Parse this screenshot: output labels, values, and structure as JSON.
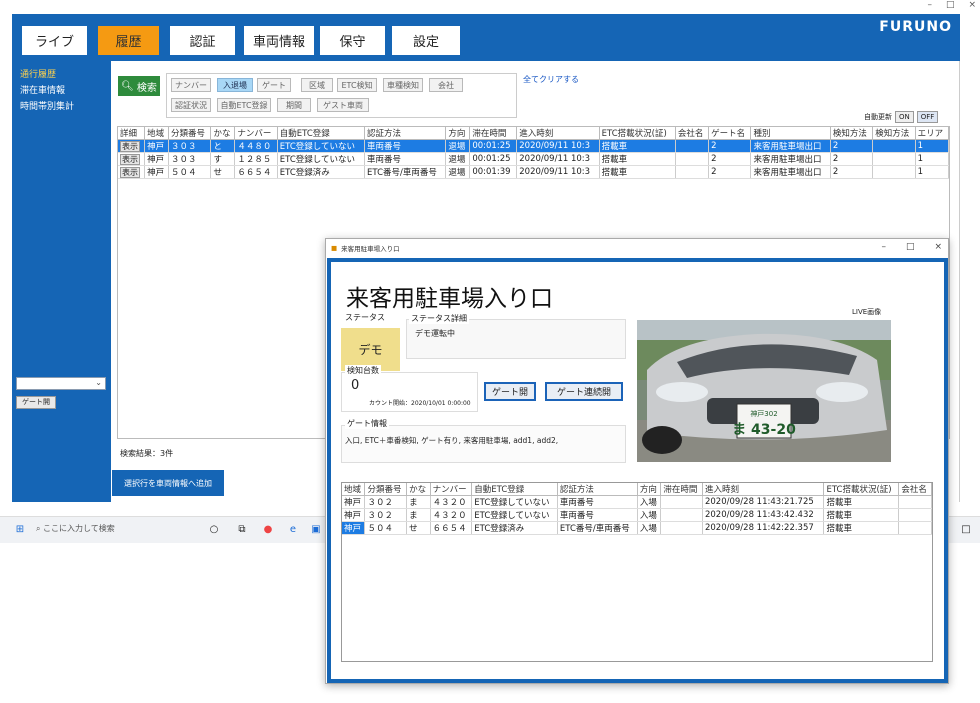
{
  "window": {
    "controls": [
      "–",
      "□",
      "×"
    ]
  },
  "brand": "FURUNO",
  "tabs": [
    {
      "label": "ライブ",
      "active": false
    },
    {
      "label": "履歴",
      "active": true
    },
    {
      "label": "認証",
      "active": false
    },
    {
      "label": "車両情報",
      "active": false
    },
    {
      "label": "保守",
      "active": false
    },
    {
      "label": "設定",
      "active": false
    }
  ],
  "sidebar": {
    "items": [
      "通行履歴",
      "滞在車情報",
      "時間帯別集計"
    ],
    "select_value": "",
    "gate_button": "ゲート開"
  },
  "search": {
    "label": "検索"
  },
  "filters": {
    "row1": [
      "ナンバー",
      "入退場",
      "ゲート",
      "区域",
      "ETC検知",
      "車種検知",
      "会社"
    ],
    "row2": [
      "認証状況",
      "自動ETC登録",
      "期間",
      "ゲスト車両"
    ],
    "active": "入退場"
  },
  "clear_all": "全てクリアする",
  "auto_update": {
    "label": "自動更新",
    "on": "ON",
    "off": "OFF"
  },
  "history_table": {
    "columns": [
      "詳細",
      "地域",
      "分類番号",
      "かな",
      "ナンバー",
      "自動ETC登録",
      "認証方法",
      "方向",
      "滞在時間",
      "進入時刻",
      "ETC搭載状況(証)",
      "会社名",
      "ゲート名",
      "種別",
      "検知方法",
      "検知方法",
      "エリア"
    ],
    "rows": [
      {
        "btn": "表示",
        "cells": [
          "神戸",
          "３０３",
          "と",
          "４４８０",
          "ETC登録していない",
          "車両番号",
          "退場",
          "00:01:25",
          "2020/09/11 10:3",
          "搭載車",
          "",
          "2",
          "来客用駐車場出口",
          "2",
          "",
          "1"
        ]
      },
      {
        "btn": "表示",
        "cells": [
          "神戸",
          "３０３",
          "す",
          "１２８５",
          "ETC登録していない",
          "車両番号",
          "退場",
          "00:01:25",
          "2020/09/11 10:3",
          "搭載車",
          "",
          "2",
          "来客用駐車場出口",
          "2",
          "",
          "1"
        ]
      },
      {
        "btn": "表示",
        "cells": [
          "神戸",
          "５０４",
          "せ",
          "６６５４",
          "ETC登録済み",
          "ETC番号/車両番号",
          "退場",
          "00:01:39",
          "2020/09/11 10:3",
          "搭載車",
          "",
          "2",
          "来客用駐車場出口",
          "2",
          "",
          "1"
        ]
      }
    ]
  },
  "result_count": "検索結果：3件",
  "add_button": "選択行を車両情報へ追加",
  "taskbar": {
    "search_placeholder": "ここに入力して検索"
  },
  "popup": {
    "window_title": "来客用駐車場入り口",
    "heading": "来客用駐車場入り口",
    "status_label": "ステータス",
    "status_value": "デモ",
    "status_detail_label": "ステータス詳細",
    "status_detail_value": "デモ運転中",
    "detect_label": "検知台数",
    "detect_count": "0",
    "count_start": "カウント開始：2020/10/01 0:00:00",
    "gate_open": "ゲート開",
    "gate_continuous": "ゲート連続開",
    "gate_info_label": "ゲート情報",
    "gate_info_value": "入口, ETC＋車番検知, ゲート有り, 来客用駐車場, add1, add2,",
    "live_label": "LIVE画像",
    "plate_top": "神戸302",
    "plate_bottom": "ま 43-20",
    "table": {
      "columns": [
        "地域",
        "分類番号",
        "かな",
        "ナンバー",
        "自動ETC登録",
        "認証方法",
        "方向",
        "滞在時間",
        "進入時刻",
        "ETC搭載状況(証)",
        "会社名"
      ],
      "rows": [
        {
          "cells": [
            "神戸",
            "３０２",
            "ま",
            "４３２０",
            "ETC登録していない",
            "車両番号",
            "入場",
            "",
            "2020/09/28 11:43:21.725",
            "搭載車",
            ""
          ],
          "selected": false
        },
        {
          "cells": [
            "神戸",
            "３０２",
            "ま",
            "４３２０",
            "ETC登録していない",
            "車両番号",
            "入場",
            "",
            "2020/09/28 11:43:42.432",
            "搭載車",
            ""
          ],
          "selected": false
        },
        {
          "cells": [
            "神戸",
            "５０４",
            "せ",
            "６６５４",
            "ETC登録済み",
            "ETC番号/車両番号",
            "入場",
            "",
            "2020/09/28 11:42:22.357",
            "搭載車",
            ""
          ],
          "selected": true
        }
      ]
    }
  }
}
